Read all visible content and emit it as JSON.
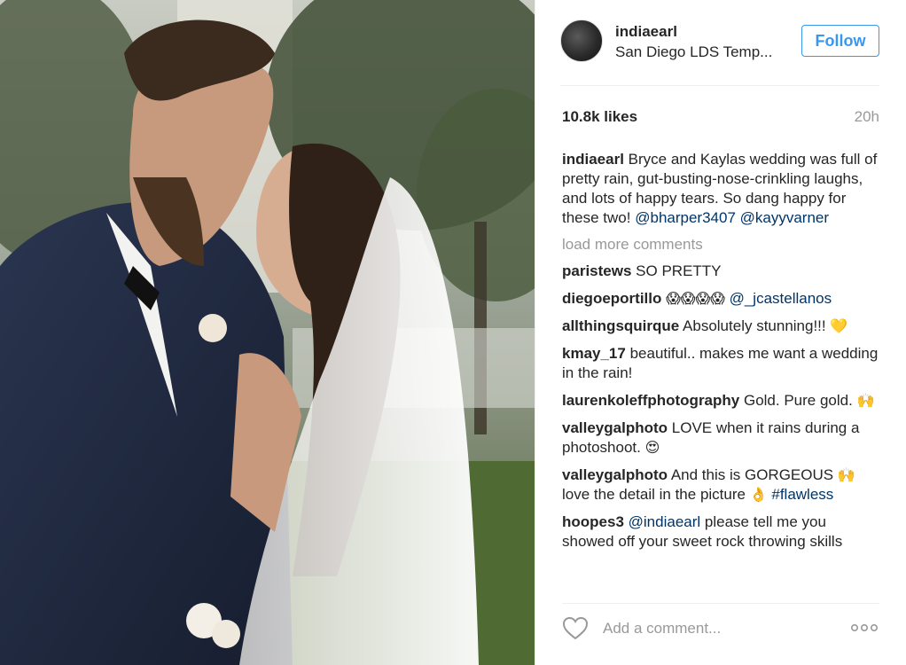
{
  "post": {
    "username": "indiaearl",
    "location": "San Diego LDS Temp...",
    "follow_label": "Follow",
    "likes": "10.8k likes",
    "time": "20h",
    "caption": {
      "user": "indiaearl",
      "text": "Bryce and Kaylas wedding was full of pretty rain, gut-busting-nose-crinkling laughs, and lots of happy tears. So dang happy for these two!",
      "mention1": "@bharper3407",
      "mention2": "@kayyvarner"
    },
    "load_more": "load more comments",
    "comments": [
      {
        "user": "paristews",
        "text": "SO PRETTY"
      },
      {
        "user": "diegoeportillo",
        "emoji": "😱😱😱😱",
        "mention": "@_jcastellanos"
      },
      {
        "user": "allthingsquirque",
        "text": "Absolutely stunning!!!",
        "emoji": "💛"
      },
      {
        "user": "kmay_17",
        "text": "beautiful.. makes me want a wedding in the rain!"
      },
      {
        "user": "laurenkoleffphotography",
        "text": "Gold. Pure gold.",
        "emoji": "🙌"
      },
      {
        "user": "valleygalphoto",
        "text": "LOVE when it rains during a photoshoot.",
        "emoji": "😍"
      },
      {
        "user": "valleygalphoto",
        "text": "And this is GORGEOUS",
        "emoji": "🙌",
        "text2": "love the detail in the picture",
        "emoji2": "👌",
        "hashtag": "#flawless"
      },
      {
        "user": "hoopes3",
        "mention": "@indiaearl",
        "text": "please tell me you showed off your sweet rock throwing skills"
      }
    ],
    "add_comment_placeholder": "Add a comment...",
    "icons": {
      "like": "heart-icon",
      "more": "more-options-icon",
      "avatar": "avatar"
    },
    "colors": {
      "accent": "#3897f0",
      "mention": "#003569",
      "muted": "#999999"
    }
  }
}
